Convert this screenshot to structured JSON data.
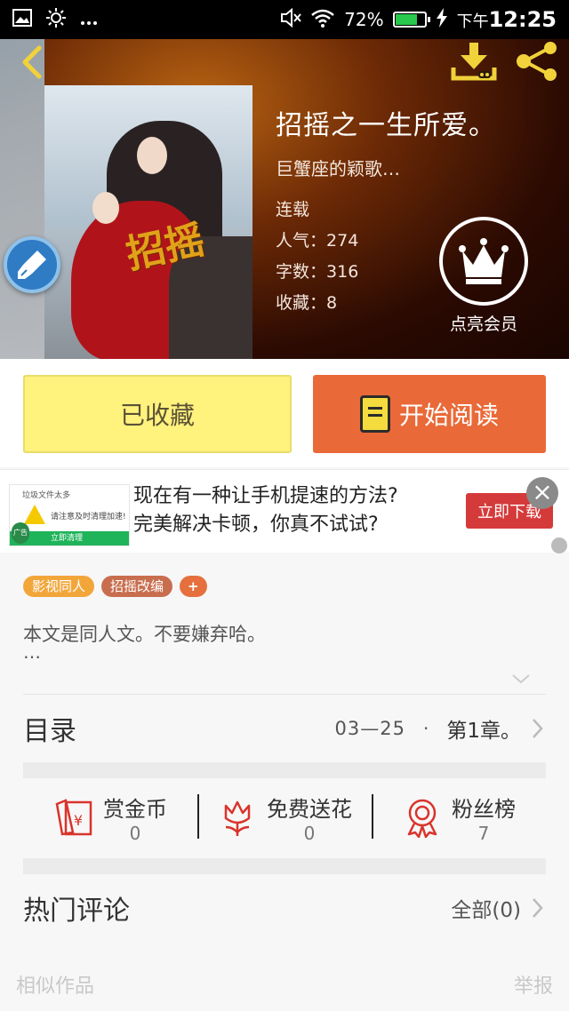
{
  "status_bar": {
    "battery_percent": "72%",
    "battery_level": 0.72,
    "ampm": "下午",
    "time": "12:25",
    "icons": [
      "image-icon",
      "brightness-icon",
      "more-dots-icon",
      "mute-icon",
      "wifi-icon",
      "battery-icon",
      "charging-icon"
    ]
  },
  "book": {
    "title": "招摇之一生所爱。",
    "author": "巨蟹座的颖歌…",
    "status": "连载",
    "popularity_label": "人气：",
    "popularity": "274",
    "word_count_label": "字数：",
    "word_count": "316",
    "favorites_label": "收藏：",
    "favorites": "8",
    "cover_calligraphy": "招摇"
  },
  "vip": {
    "label": "点亮会员"
  },
  "actions": {
    "favorited_label": "已收藏",
    "start_reading_label": "开始阅读"
  },
  "ad": {
    "thumb_title": "垃圾文件太多",
    "thumb_warning": "请注意及时清理加速!",
    "thumb_button": "立即清理",
    "thumb_tag": "广告",
    "line1": "现在有一种让手机提速的方法?",
    "line2": "完美解决卡顿，你真不试试?",
    "download_label": "立即下载",
    "close_symbol": "×"
  },
  "tags": [
    "影视同人",
    "招摇改编",
    "+"
  ],
  "intro": {
    "text": "本文是同人文。不要嫌弃哈。",
    "more": "…"
  },
  "toc": {
    "label": "目录",
    "date": "03—25",
    "dot": "·",
    "chapter": "第1章。"
  },
  "rewards": [
    {
      "name": "赏金币",
      "count": "0"
    },
    {
      "name": "免费送花",
      "count": "0"
    },
    {
      "name": "粉丝榜",
      "count": "7"
    }
  ],
  "comments": {
    "label": "热门评论",
    "all": "全部(0)"
  },
  "footer": {
    "similar": "相似作品",
    "report": "举报"
  },
  "colors": {
    "accent_orange": "#e96a38",
    "favorite_yellow": "#fff27d",
    "reward_red": "#d9342c"
  }
}
